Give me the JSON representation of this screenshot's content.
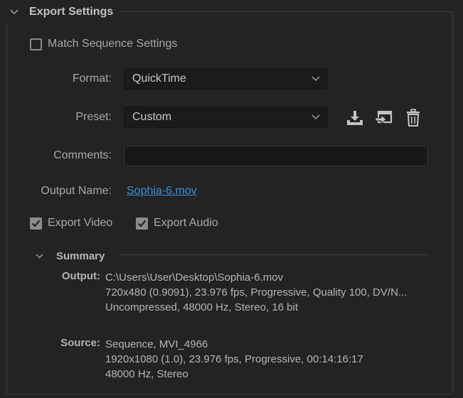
{
  "section": {
    "title": "Export Settings"
  },
  "match_sequence": {
    "label": "Match Sequence Settings",
    "checked": false
  },
  "format": {
    "label": "Format:",
    "value": "QuickTime"
  },
  "preset": {
    "label": "Preset:",
    "value": "Custom",
    "icons": [
      "save-preset-icon",
      "import-preset-icon",
      "delete-preset-icon"
    ]
  },
  "comments": {
    "label": "Comments:",
    "value": ""
  },
  "output_name": {
    "label": "Output Name:",
    "value": "Sophia-6.mov"
  },
  "export_video": {
    "label": "Export Video",
    "checked": true
  },
  "export_audio": {
    "label": "Export Audio",
    "checked": true
  },
  "summary": {
    "title": "Summary",
    "output_label": "Output:",
    "output_lines": [
      "C:\\Users\\User\\Desktop\\Sophia-6.mov",
      "720x480 (0.9091), 23.976 fps, Progressive, Quality 100, DV/N...",
      "Uncompressed, 48000 Hz, Stereo, 16 bit"
    ],
    "source_label": "Source:",
    "source_lines": [
      "Sequence, MVI_4966",
      "1920x1080 (1.0), 23.976 fps, Progressive, 00:14:16:17",
      "48000 Hz, Stereo"
    ]
  },
  "colors": {
    "background": "#232323",
    "link": "#3d8ee0",
    "text": "#a8a8a8"
  }
}
